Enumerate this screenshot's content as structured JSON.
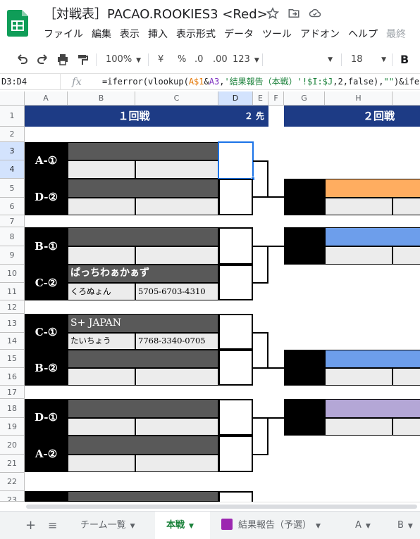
{
  "app": {
    "doc_title": "［対戦表］PACAO.ROOKIES3 <Red>",
    "menus": [
      "ファイル",
      "編集",
      "表示",
      "挿入",
      "表示形式",
      "データ",
      "ツール",
      "アドオン",
      "ヘルプ"
    ],
    "last_edit_label": "最終",
    "colors": {
      "sheets_green": "#0f9d58",
      "navy": "#1d3b85",
      "dark_cell": "#595959",
      "light_cell": "#ececec",
      "orange": "#ffad60",
      "blue": "#6d9eeb",
      "purple": "#b4a7d6",
      "active_tab": "#188038"
    }
  },
  "toolbar": {
    "zoom": "100%",
    "currency": "¥",
    "percent": "%",
    "dec_decrease": ".0",
    "dec_increase": ".00",
    "format_more": "123",
    "font_size": "18",
    "bold": "B"
  },
  "formula_bar": {
    "name_box": "D3:D4",
    "fx": "fx",
    "f_part1": "=iferror(vlookup(",
    "f_ref1": "A$1",
    "f_part2": "&",
    "f_ref2": "A3",
    "f_part3": ",",
    "f_str1": "'結果報告（本戦）'!$I:$J",
    "f_part4": ",2,false),",
    "f_str2": "\"\"",
    "f_part5": ")&ife"
  },
  "columns": [
    "A",
    "B",
    "C",
    "D",
    "E",
    "F",
    "G",
    "H"
  ],
  "rows": [
    "1",
    "2",
    "3",
    "4",
    "5",
    "6",
    "7",
    "8",
    "9",
    "10",
    "11",
    "12",
    "13",
    "14",
    "15",
    "16",
    "17",
    "18",
    "19",
    "20",
    "21",
    "22",
    "23"
  ],
  "sheet": {
    "round1_header": "１回戦",
    "round1_note": "２ 先",
    "round2_header": "２回戦",
    "labels": {
      "a1": "A-①",
      "d2": "D-②",
      "b1": "B-①",
      "c2": "C-②",
      "c1": "C-①",
      "b2": "B-②",
      "d1": "D-①",
      "a2": "A-②"
    },
    "c2_team_name": "ぱっちわぁかぁず",
    "c2_rep": "くろぬょん",
    "c2_id": "5705-6703-4310",
    "c1_team_name": "S+ JAPAN",
    "c1_rep": "たいちょう",
    "c1_id": "7768-3340-0705"
  },
  "sheet_tabs": {
    "add": "+",
    "list": "≡",
    "tabs": [
      "チーム一覧",
      "本戦",
      "結果報告（予選）",
      "A",
      "B"
    ],
    "active": "本戦"
  }
}
